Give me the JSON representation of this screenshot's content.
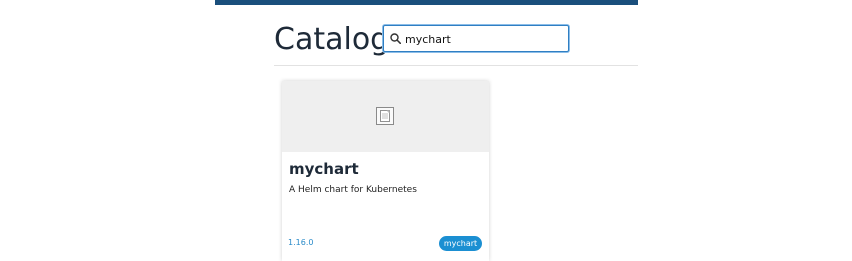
{
  "header": {
    "accent_color": "#1a4f7c"
  },
  "catalog": {
    "title": "Catalog",
    "search": {
      "value": "mychart",
      "placeholder": "",
      "icon": "search-icon"
    }
  },
  "cards": [
    {
      "image_icon": "image-placeholder-icon",
      "title": "mychart",
      "description": "A Helm chart for Kubernetes",
      "version": "1.16.0",
      "badge": "mychart",
      "badge_color": "#1b8fd2"
    }
  ]
}
